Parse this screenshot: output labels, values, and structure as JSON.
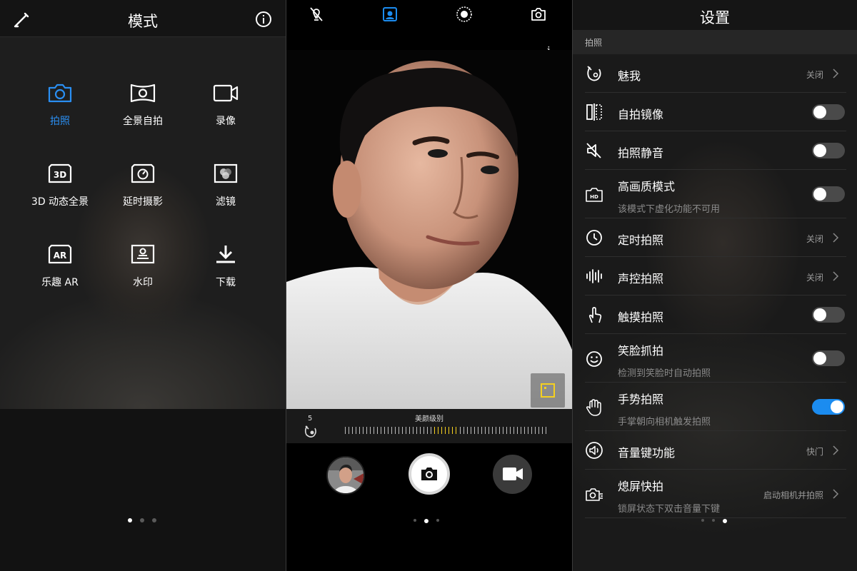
{
  "mode_panel": {
    "title": "模式",
    "modes": [
      {
        "label": "拍照",
        "icon": "camera-icon",
        "active": true
      },
      {
        "label": "全景自拍",
        "icon": "panorama-selfie-icon"
      },
      {
        "label": "录像",
        "icon": "video-icon"
      },
      {
        "label": "3D 动态全景",
        "icon": "3d-panorama-icon"
      },
      {
        "label": "延时摄影",
        "icon": "timelapse-icon"
      },
      {
        "label": "滤镜",
        "icon": "filter-icon"
      },
      {
        "label": "乐趣 AR",
        "icon": "ar-icon"
      },
      {
        "label": "水印",
        "icon": "watermark-icon"
      },
      {
        "label": "下载",
        "icon": "download-icon"
      }
    ],
    "page_dots": {
      "count": 3,
      "active": 0
    }
  },
  "camera_panel": {
    "top_icons": [
      "flash-off-icon",
      "portrait-mode-icon",
      "aperture-icon",
      "switch-camera-icon"
    ],
    "info_label": "i",
    "beauty": {
      "label": "美颜级别",
      "level": "5",
      "level_value": 5,
      "max": 10
    },
    "page_dots": {
      "count": 3,
      "active": 1
    },
    "accent_color": "#1b8cf0",
    "beauty_tick_color": "#f5d020"
  },
  "settings_panel": {
    "title": "设置",
    "section": "拍照",
    "rows": [
      {
        "title": "魅我",
        "value": "关闭",
        "icon": "beauty-face-icon",
        "type": "link"
      },
      {
        "title": "自拍镜像",
        "icon": "mirror-icon",
        "type": "toggle",
        "on": false
      },
      {
        "title": "拍照静音",
        "icon": "mute-icon",
        "type": "toggle",
        "on": false
      },
      {
        "title": "高画质模式",
        "subtitle": "该模式下虚化功能不可用",
        "icon": "hd-icon",
        "type": "toggle",
        "on": false
      },
      {
        "title": "定时拍照",
        "value": "关闭",
        "icon": "timer-icon",
        "type": "link"
      },
      {
        "title": "声控拍照",
        "value": "关闭",
        "icon": "sound-wave-icon",
        "type": "link"
      },
      {
        "title": "触摸拍照",
        "icon": "touch-icon",
        "type": "toggle",
        "on": false
      },
      {
        "title": "笑脸抓拍",
        "subtitle": "检测到笑脸时自动拍照",
        "icon": "smile-icon",
        "type": "toggle",
        "on": false
      },
      {
        "title": "手势拍照",
        "subtitle": "手掌朝向相机触发拍照",
        "icon": "palm-icon",
        "type": "toggle",
        "on": true
      },
      {
        "title": "音量键功能",
        "value": "快门",
        "icon": "volume-icon",
        "type": "link"
      },
      {
        "title": "熄屏快拍",
        "subtitle": "锁屏状态下双击音量下键",
        "value": "启动相机并拍照",
        "icon": "quick-snap-icon",
        "type": "link"
      }
    ],
    "page_dots": {
      "count": 3,
      "active": 2
    }
  }
}
